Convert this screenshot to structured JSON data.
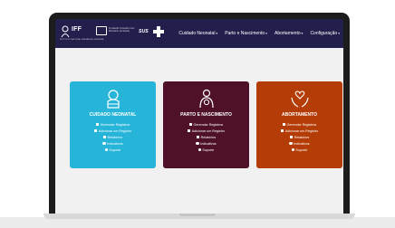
{
  "header": {
    "logo_text": "IFF",
    "logo_subtitle": "INSTITUTO NACIONAL FERNANDES FIGUEIRA",
    "mgmt_text_line1": "Fundação Oswaldo Cruz",
    "mgmt_text_line2": "Ministério da Saúde",
    "sus_label": "SUS"
  },
  "nav": [
    {
      "label": "Cuidado Neonatal"
    },
    {
      "label": "Parto e Nascimento"
    },
    {
      "label": "Abortamento"
    },
    {
      "label": "Configuração"
    }
  ],
  "cards": [
    {
      "title": "CUIDADO NEONATAL",
      "color": "#27b4d9",
      "icon": "baby-icon",
      "links": [
        "Gerenciar Registros",
        "Adicionar um Registro",
        "Relatórios",
        "Indicativos",
        "Suporte"
      ]
    },
    {
      "title": "PARTO E NASCIMENTO",
      "color": "#4e1129",
      "icon": "mother-child-icon",
      "links": [
        "Gerenciar Registros",
        "Adicionar um Registro",
        "Relatórios",
        "Indicativos",
        "Suporte"
      ]
    },
    {
      "title": "ABORTAMENTO",
      "color": "#b43c07",
      "icon": "hands-heart-icon",
      "links": [
        "Gerenciar Registros",
        "Adicionar um Registro",
        "Relatórios",
        "Indicativos",
        "Suporte"
      ]
    }
  ],
  "colors": {
    "navbar": "#231f4d",
    "page_background": "#f1f1f1"
  }
}
